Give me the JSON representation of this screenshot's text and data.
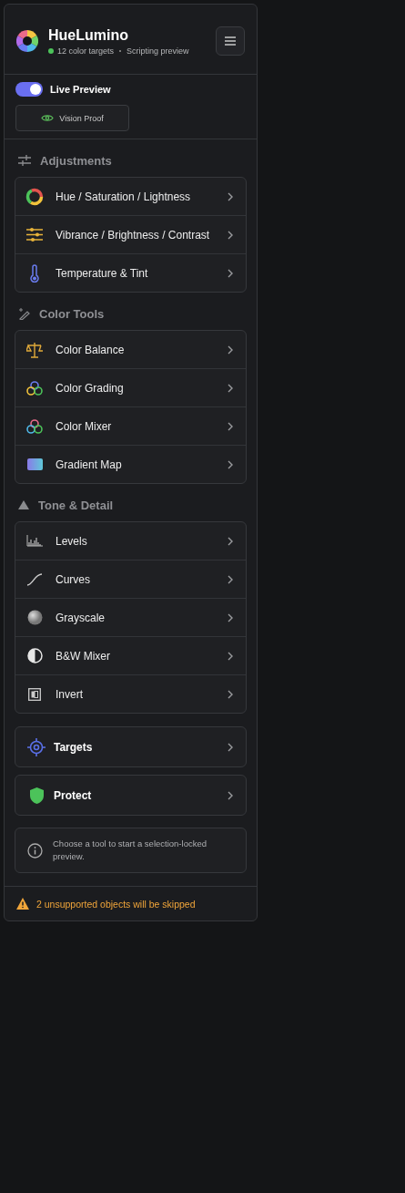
{
  "header": {
    "title": "HueLumino",
    "status": "12 color targets",
    "connected": true,
    "mode": "Scripting preview"
  },
  "live_preview": {
    "label": "Live Preview",
    "on": true
  },
  "vision_proof": {
    "label": "Vision Proof"
  },
  "sections": [
    {
      "title": "Adjustments",
      "items": [
        {
          "label": "Hue / Saturation / Lightness"
        },
        {
          "label": "Vibrance / Brightness / Contrast"
        },
        {
          "label": "Temperature & Tint"
        }
      ]
    },
    {
      "title": "Color Tools",
      "items": [
        {
          "label": "Color Balance"
        },
        {
          "label": "Color Grading"
        },
        {
          "label": "Color Mixer"
        },
        {
          "label": "Gradient Map"
        }
      ]
    },
    {
      "title": "Tone & Detail",
      "items": [
        {
          "label": "Levels"
        },
        {
          "label": "Curves"
        },
        {
          "label": "Grayscale"
        },
        {
          "label": "B&W Mixer"
        },
        {
          "label": "Invert"
        }
      ]
    }
  ],
  "actions": [
    {
      "label": "Targets"
    },
    {
      "label": "Protect"
    }
  ],
  "info": "Choose a tool to start a selection-locked preview.",
  "warning": "2 unsupported objects will be skipped"
}
